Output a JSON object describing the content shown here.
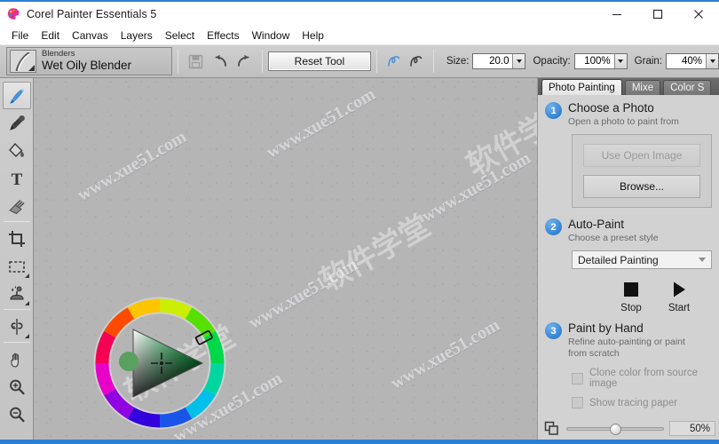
{
  "window": {
    "title": "Corel Painter Essentials 5",
    "app_icon": "palette-icon",
    "controls": {
      "minimize": "minimize-icon",
      "maximize": "maximize-icon",
      "close": "close-icon"
    },
    "accent_color": "#2a7fd4"
  },
  "menu": {
    "items": [
      "File",
      "Edit",
      "Canvas",
      "Layers",
      "Select",
      "Effects",
      "Window",
      "Help"
    ]
  },
  "toolbar": {
    "brush": {
      "category": "Blenders",
      "name": "Wet Oily Blender",
      "preview_icon": "brush-stroke-icon"
    },
    "save_icon": "save-icon",
    "undo_icon": "undo-icon",
    "redo_icon": "redo-icon",
    "reset_label": "Reset Tool",
    "symmetry_icons": [
      "freehand-stroke-icon",
      "straight-stroke-icon"
    ],
    "params": [
      {
        "label": "Size:",
        "value": "20.0"
      },
      {
        "label": "Opacity:",
        "value": "100%"
      },
      {
        "label": "Grain:",
        "value": "40%"
      }
    ]
  },
  "tools": [
    {
      "name": "brush-tool",
      "icon": "paintbrush-icon",
      "active": true,
      "flyout": false
    },
    {
      "name": "dropper-tool",
      "icon": "eyedropper-icon",
      "active": false,
      "flyout": false
    },
    {
      "name": "paint-bucket-tool",
      "icon": "paint-bucket-icon",
      "active": false,
      "flyout": false
    },
    {
      "name": "text-tool",
      "icon": "text-icon",
      "active": false,
      "flyout": false
    },
    {
      "name": "eraser-tool",
      "icon": "eraser-icon",
      "active": false,
      "flyout": false
    },
    {
      "name": "crop-tool",
      "icon": "crop-icon",
      "active": false,
      "flyout": false
    },
    {
      "name": "rectangular-select-tool",
      "icon": "marquee-icon",
      "active": false,
      "flyout": true
    },
    {
      "name": "magic-wand-tool",
      "icon": "magic-wand-icon",
      "active": false,
      "flyout": true
    },
    {
      "name": "mirror-tool",
      "icon": "mirror-symmetry-icon",
      "active": false,
      "flyout": true
    },
    {
      "name": "hand-tool",
      "icon": "hand-icon",
      "active": false,
      "flyout": false
    },
    {
      "name": "zoom-in-tool",
      "icon": "magnifier-plus-icon",
      "active": false,
      "flyout": false
    },
    {
      "name": "zoom-out-tool",
      "icon": "magnifier-minus-icon",
      "active": false,
      "flyout": false
    }
  ],
  "canvas": {
    "background_color": "#b5b5b5",
    "watermarks": [
      "www.xue51.com",
      "www.xue51.com",
      "www.xue51.com",
      "www.xue51.com",
      "www.xue51.com",
      "www.xue51.com"
    ],
    "watermark_cn": [
      "软件学堂",
      "软件学堂",
      "软件学堂"
    ],
    "color_wheel": {
      "name": "color-wheel",
      "selected_hue": "#00d84a",
      "selected_color": "#57a35c",
      "hue_marker_angle_deg": 35,
      "triangle_marker": "crosshair-icon"
    }
  },
  "panel": {
    "tabs": [
      {
        "label": "Photo Painting",
        "active": true
      },
      {
        "label": "Mixe",
        "active": false
      },
      {
        "label": "Color S",
        "active": false
      }
    ],
    "steps": [
      {
        "num": "1",
        "title": "Choose a Photo",
        "subtitle": "Open a photo to paint from",
        "buttons": [
          {
            "label": "Use Open Image",
            "disabled": true
          },
          {
            "label": "Browse...",
            "disabled": false
          }
        ]
      },
      {
        "num": "2",
        "title": "Auto-Paint",
        "subtitle": "Choose a preset style",
        "select_value": "Detailed Painting",
        "transport": [
          {
            "label": "Stop",
            "icon": "stop-square-icon"
          },
          {
            "label": "Start",
            "icon": "play-triangle-icon"
          }
        ]
      },
      {
        "num": "3",
        "title": "Paint by Hand",
        "subtitle": "Refine auto-painting or paint from scratch",
        "checkboxes": [
          {
            "label": "Clone color from source image",
            "checked": false
          },
          {
            "label": "Show tracing paper",
            "checked": false
          }
        ]
      }
    ],
    "opacity_slider": {
      "icon": "layers-overlap-icon",
      "value": "50%",
      "percent": 50
    }
  }
}
